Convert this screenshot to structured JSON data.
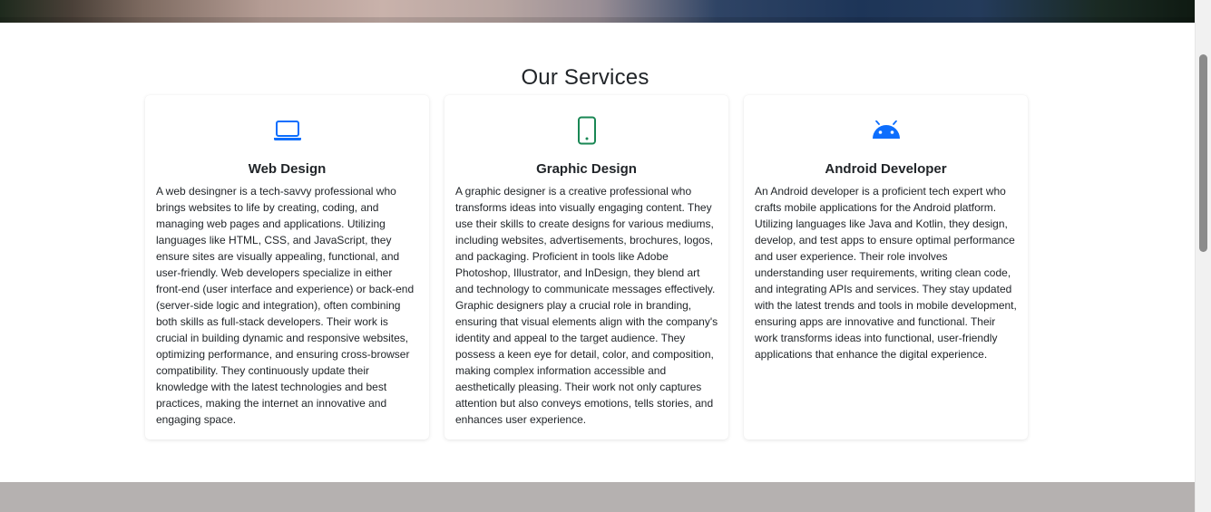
{
  "services": {
    "heading": "Our Services",
    "cards": [
      {
        "icon": "laptop-icon",
        "icon_color": "#0d6efd",
        "title": "Web Design",
        "description": "A web desingner is a tech-savvy professional who brings websites to life by creating, coding, and managing web pages and applications. Utilizing languages like HTML, CSS, and JavaScript, they ensure sites are visually appealing, functional, and user-friendly. Web developers specialize in either front-end (user interface and experience) or back-end (server-side logic and integration), often combining both skills as full-stack developers. Their work is crucial in building dynamic and responsive websites, optimizing performance, and ensuring cross-browser compatibility. They continuously update their knowledge with the latest technologies and best practices, making the internet an innovative and engaging space."
      },
      {
        "icon": "phone-icon",
        "icon_color": "#198754",
        "title": "Graphic Design",
        "description": "A graphic designer is a creative professional who transforms ideas into visually engaging content. They use their skills to create designs for various mediums, including websites, advertisements, brochures, logos, and packaging. Proficient in tools like Adobe Photoshop, Illustrator, and InDesign, they blend art and technology to communicate messages effectively. Graphic designers play a crucial role in branding, ensuring that visual elements align with the company's identity and appeal to the target audience. They possess a keen eye for detail, color, and composition, making complex information accessible and aesthetically pleasing. Their work not only captures attention but also conveys emotions, tells stories, and enhances user experience."
      },
      {
        "icon": "android-icon",
        "icon_color": "#0d6efd",
        "title": "Android Developer",
        "description": "An Android developer is a proficient tech expert who crafts mobile applications for the Android platform. Utilizing languages like Java and Kotlin, they design, develop, and test apps to ensure optimal performance and user experience. Their role involves understanding user requirements, writing clean code, and integrating APIs and services. They stay updated with the latest trends and tools in mobile development, ensuring apps are innovative and functional. Their work transforms ideas into functional, user-friendly applications that enhance the digital experience."
      }
    ]
  }
}
